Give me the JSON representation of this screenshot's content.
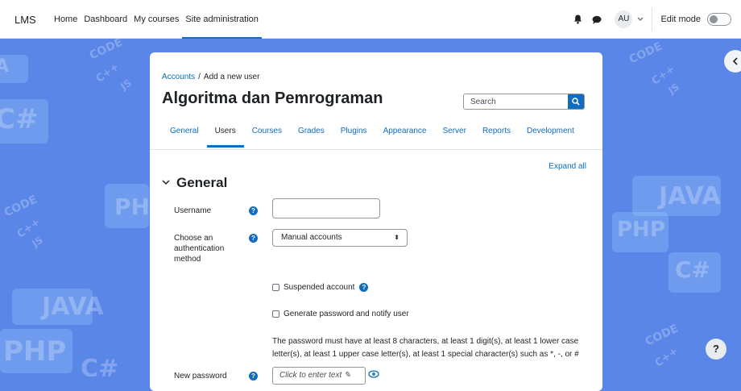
{
  "navbar": {
    "brand": "LMS",
    "links": [
      {
        "label": "Home",
        "active": false
      },
      {
        "label": "Dashboard",
        "active": false
      },
      {
        "label": "My courses",
        "active": false
      },
      {
        "label": "Site administration",
        "active": true
      }
    ],
    "user_initials": "AU",
    "edit_mode_label": "Edit mode"
  },
  "background_words": {
    "code": "CODE",
    "cpp": "C++",
    "js": "JS",
    "cs": "C#",
    "php": "PHP",
    "java": "JAVA"
  },
  "breadcrumb": {
    "accounts": "Accounts",
    "separator": "/",
    "current": "Add a new user"
  },
  "page_title": "Algoritma dan Pemrograman",
  "search": {
    "placeholder": "Search"
  },
  "tabs": [
    "General",
    "Users",
    "Courses",
    "Grades",
    "Plugins",
    "Appearance",
    "Server",
    "Reports",
    "Development"
  ],
  "active_tab": "Users",
  "expand_all": "Expand all",
  "section_title": "General",
  "form": {
    "username_label": "Username",
    "username_value": "",
    "auth_label": "Choose an authentication method",
    "auth_value": "Manual accounts",
    "suspended_label": "Suspended account",
    "generate_label": "Generate password and notify user",
    "password_note": "The password must have at least 8 characters, at least 1 digit(s), at least 1 lower case letter(s), at least 1 upper case letter(s), at least 1 special character(s) such as *, -, or #",
    "new_password_label": "New password",
    "new_password_placeholder": "Click to enter text"
  },
  "help_button": "?",
  "colors": {
    "background": "#5a86e8",
    "accent": "#0f6cbf"
  }
}
